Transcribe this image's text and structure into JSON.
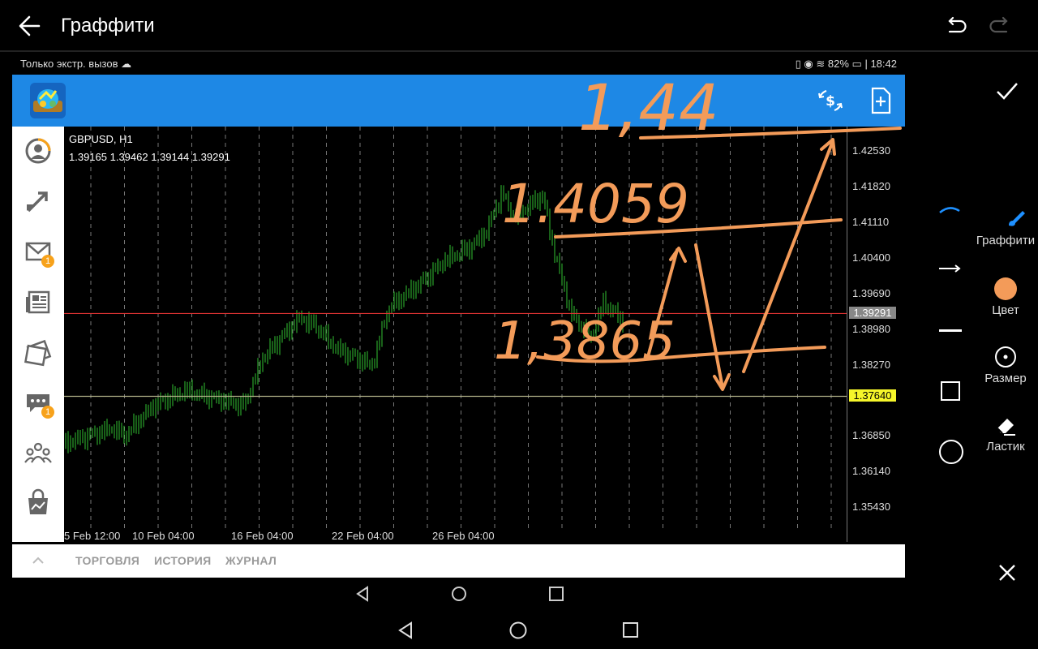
{
  "editor": {
    "title": "Граффити",
    "icons": [
      "back-arrow-icon",
      "undo-icon",
      "redo-icon",
      "checkmark-icon",
      "close-icon"
    ]
  },
  "status_bar": {
    "left": "Только экстр. вызов",
    "battery": "82%",
    "time": "18:42"
  },
  "chart_panel": {
    "symbol": "GBPUSD, H1",
    "ohlc": "1.39165 1.39462 1.39144 1.39291",
    "price_ticks": [
      "1.42530",
      "1.41820",
      "1.41110",
      "1.40400",
      "1.39690",
      "1.38980",
      "1.38270",
      "1.36850",
      "1.36140",
      "1.35430"
    ],
    "current_price": "1.39291",
    "level_price": "1.37640",
    "time_ticks": [
      "5 Feb 12:00",
      "10 Feb 04:00",
      "16 Feb 04:00",
      "22 Feb 04:00",
      "26 Feb 04:00"
    ],
    "colors": {
      "candles": "#32c232",
      "bid_line": "#d33",
      "level_line": "#b5b58a",
      "level_tag": "#f6f62a",
      "grid": "#aaaaaa"
    }
  },
  "bottom_tabs": [
    "ТОРГОВЛЯ",
    "ИСТОРИЯ",
    "ЖУРНАЛ"
  ],
  "sidebar_badges": {
    "mail": "1",
    "chat": "1"
  },
  "annotations": {
    "color": "#f39b59",
    "texts": [
      "1,44",
      "1.4059",
      "1,3865"
    ]
  },
  "tools": {
    "graffiti": "Граффити",
    "color": "Цвет",
    "size": "Размер",
    "eraser": "Ластик"
  }
}
